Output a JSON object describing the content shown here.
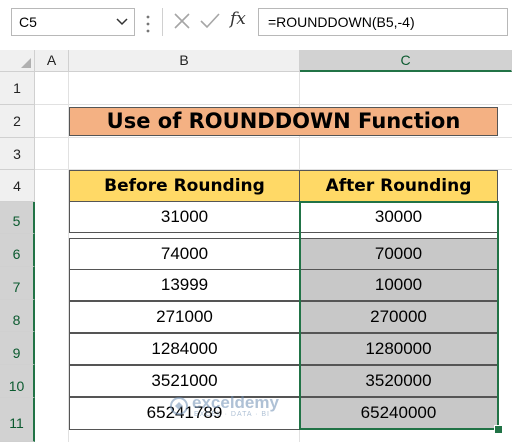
{
  "formula_bar": {
    "name_box": "C5",
    "formula": "=ROUNDDOWN(B5,-4)",
    "cancel_icon": "cancel-x-icon",
    "enter_icon": "checkmark-icon",
    "fx_label": "fx"
  },
  "columns": [
    "A",
    "B",
    "C"
  ],
  "rows": [
    "1",
    "2",
    "3",
    "4",
    "5",
    "6",
    "7",
    "8",
    "9",
    "10",
    "11"
  ],
  "selected": {
    "column": "C",
    "rows": [
      "5",
      "6",
      "7",
      "8",
      "9",
      "10",
      "11"
    ]
  },
  "title": "Use of ROUNDDOWN Function",
  "table": {
    "headers": [
      "Before Rounding",
      "After Rounding"
    ],
    "rows": [
      [
        "31000",
        "30000"
      ],
      [
        "74000",
        "70000"
      ],
      [
        "13999",
        "10000"
      ],
      [
        "271000",
        "270000"
      ],
      [
        "1284000",
        "1280000"
      ],
      [
        "3521000",
        "3520000"
      ],
      [
        "65241789",
        "65240000"
      ]
    ]
  },
  "watermark": {
    "name": "exceldemy",
    "tagline": "EXCEL · DATA · BI"
  },
  "colors": {
    "title_fill": "#f4b183",
    "header_fill": "#ffd966",
    "selection_green": "#217346",
    "selected_fill": "#c8c8c8"
  }
}
